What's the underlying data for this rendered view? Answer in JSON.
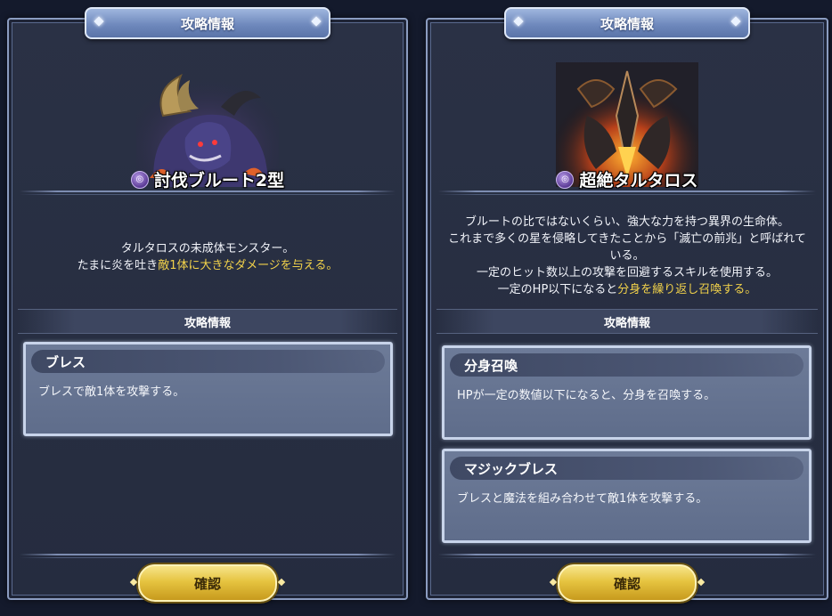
{
  "left_panel": {
    "title": "攻略情報",
    "enemy_name": "討伐ブルート2型",
    "description_line1": "タルタロスの未成体モンスター。",
    "description_line2_plain": "たまに炎を吐き",
    "description_line2_highlight": "敵1体に大きなダメージを与える。",
    "section_label": "攻略情報",
    "skills": [
      {
        "name": "ブレス",
        "desc": "ブレスで敵1体を攻撃する。"
      }
    ],
    "confirm_label": "確認"
  },
  "right_panel": {
    "title": "攻略情報",
    "enemy_name": "超絶タルタロス",
    "description_line1": "ブルートの比ではないくらい、強大な力を持つ異界の生命体。",
    "description_line2": "これまで多くの星を侵略してきたことから「滅亡の前兆」と呼ばれて",
    "description_line3": "いる。",
    "description_line4": "一定のヒット数以上の攻撃を回避するスキルを使用する。",
    "description_line5_plain": "一定のHP以下になると",
    "description_line5_highlight": "分身を繰り返し召喚する。",
    "section_label": "攻略情報",
    "skills": [
      {
        "name": "分身召喚",
        "desc": "HPが一定の数値以下になると、分身を召喚する。"
      },
      {
        "name": "マジックブレス",
        "desc": "ブレスと魔法を組み合わせて敵1体を攻撃する。"
      }
    ],
    "confirm_label": "確認"
  },
  "colors": {
    "highlight_text": "#f2d24a",
    "panel_bg": "#252c3f",
    "button_gold": "#e6c440",
    "element_icon": "#7a55c0"
  },
  "icons": {
    "element_icon": "dark-element-icon"
  }
}
